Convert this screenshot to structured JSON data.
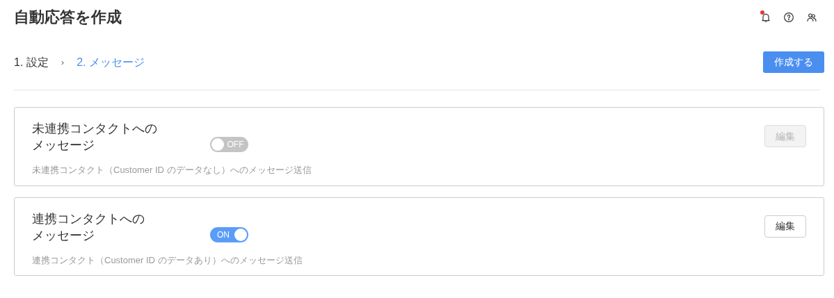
{
  "page_title": "自動応答を作成",
  "header_icons": [
    {
      "kind": "bell",
      "badge": true
    },
    {
      "kind": "help",
      "badge": false
    },
    {
      "kind": "users",
      "badge": false
    }
  ],
  "steps": [
    {
      "label": "1. 設定",
      "selected": false
    },
    {
      "label": "2. メッセージ",
      "selected": true
    }
  ],
  "step_separator": "›",
  "create_button": "作成する",
  "cards": [
    {
      "title_lines": [
        "未連携コンタクトへの",
        "メッセージ"
      ],
      "on": false,
      "toggle_label": "OFF",
      "description": "未連携コンタクト（Customer ID のデータなし）へのメッセージ送信",
      "edit_button": "編集",
      "edit_disabled": true
    },
    {
      "title_lines": [
        "連携コンタクトへの",
        "メッセージ"
      ],
      "on": true,
      "toggle_label": "ON",
      "description": "連携コンタクト（Customer ID のデータあり）へのメッセージ送信",
      "edit_button": "編集",
      "edit_disabled": false
    }
  ]
}
